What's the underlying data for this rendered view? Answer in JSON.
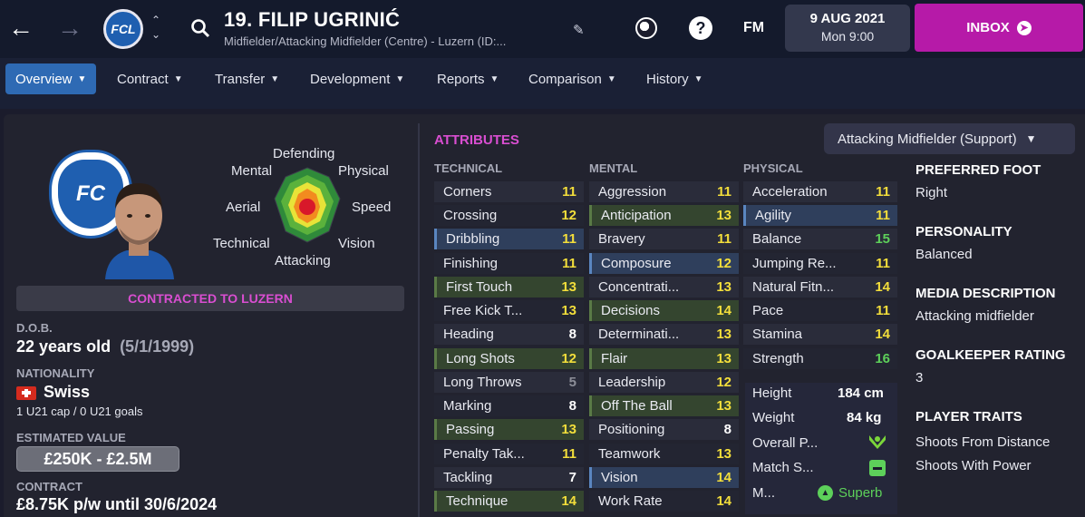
{
  "header": {
    "title": "19. FILIP UGRINIĆ",
    "subtitle": "Midfielder/Attacking Midfielder (Centre) - Luzern (ID:...",
    "club_logo_text": "FCL",
    "fm_label": "FM",
    "date": "9 AUG 2021",
    "time": "Mon 9:00",
    "inbox_label": "INBOX"
  },
  "tabs": [
    "Overview",
    "Contract",
    "Transfer",
    "Development",
    "Reports",
    "Comparison",
    "History"
  ],
  "radar_labels": {
    "top": "Defending",
    "top_left": "Mental",
    "top_right": "Physical",
    "left": "Aerial",
    "right": "Speed",
    "bottom_left": "Technical",
    "bottom_right": "Vision",
    "bottom": "Attacking"
  },
  "profile": {
    "contract_status": "CONTRACTED TO LUZERN",
    "dob_label": "D.O.B.",
    "age": "22 years old",
    "dob": "(5/1/1999)",
    "nationality_label": "NATIONALITY",
    "nationality": "Swiss",
    "caps": "1 U21 cap / 0 U21 goals",
    "value_label": "ESTIMATED VALUE",
    "value": "£250K - £2.5M",
    "contract_label": "CONTRACT",
    "contract": "£8.75K p/w until 30/6/2024"
  },
  "attributes_title": "ATTRIBUTES",
  "role": "Attacking Midfielder (Support)",
  "columns": {
    "technical": {
      "heading": "TECHNICAL",
      "items": [
        [
          "Corners",
          "11"
        ],
        [
          "Crossing",
          "12"
        ],
        [
          "Dribbling",
          "11"
        ],
        [
          "Finishing",
          "11"
        ],
        [
          "First Touch",
          "13"
        ],
        [
          "Free Kick T...",
          "13"
        ],
        [
          "Heading",
          "8"
        ],
        [
          "Long Shots",
          "12"
        ],
        [
          "Long Throws",
          "5"
        ],
        [
          "Marking",
          "8"
        ],
        [
          "Passing",
          "13"
        ],
        [
          "Penalty Tak...",
          "11"
        ],
        [
          "Tackling",
          "7"
        ],
        [
          "Technique",
          "14"
        ]
      ]
    },
    "mental": {
      "heading": "MENTAL",
      "items": [
        [
          "Aggression",
          "11"
        ],
        [
          "Anticipation",
          "13"
        ],
        [
          "Bravery",
          "11"
        ],
        [
          "Composure",
          "12"
        ],
        [
          "Concentrati...",
          "13"
        ],
        [
          "Decisions",
          "14"
        ],
        [
          "Determinati...",
          "13"
        ],
        [
          "Flair",
          "13"
        ],
        [
          "Leadership",
          "12"
        ],
        [
          "Off The Ball",
          "13"
        ],
        [
          "Positioning",
          "8"
        ],
        [
          "Teamwork",
          "13"
        ],
        [
          "Vision",
          "14"
        ],
        [
          "Work Rate",
          "14"
        ]
      ]
    },
    "physical": {
      "heading": "PHYSICAL",
      "items": [
        [
          "Acceleration",
          "11"
        ],
        [
          "Agility",
          "11"
        ],
        [
          "Balance",
          "15"
        ],
        [
          "Jumping Re...",
          "11"
        ],
        [
          "Natural Fitn...",
          "14"
        ],
        [
          "Pace",
          "11"
        ],
        [
          "Stamina",
          "14"
        ],
        [
          "Strength",
          "16"
        ]
      ]
    }
  },
  "physical_extra": {
    "height_label": "Height",
    "height": "184 cm",
    "weight_label": "Weight",
    "weight": "84 kg",
    "overall_label": "Overall P...",
    "match_label": "Match S...",
    "morale_label": "M...",
    "morale": "Superb"
  },
  "right_info": {
    "foot_label": "PREFERRED FOOT",
    "foot": "Right",
    "personality_label": "PERSONALITY",
    "personality": "Balanced",
    "media_label": "MEDIA DESCRIPTION",
    "media": "Attacking midfielder",
    "gk_label": "GOALKEEPER RATING",
    "gk": "3",
    "traits_label": "PLAYER TRAITS",
    "traits": [
      "Shoots From Distance",
      "Shoots With Power"
    ]
  }
}
